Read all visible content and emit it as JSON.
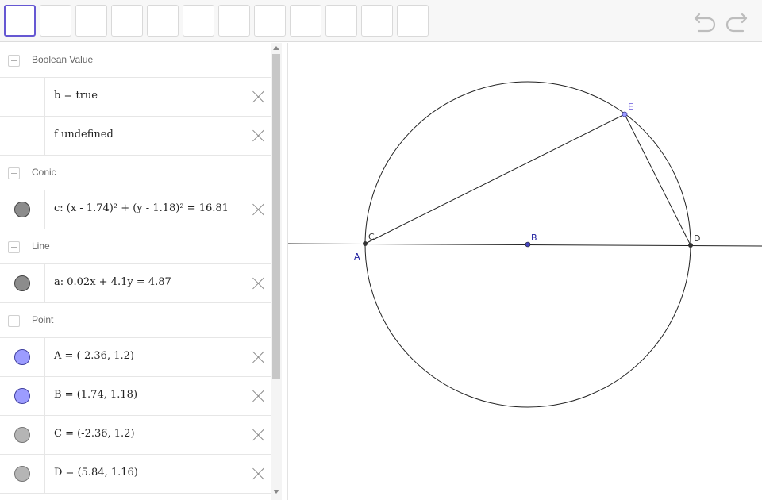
{
  "toolbar": {
    "tool_count": 12,
    "undo_icon": "undo-icon",
    "redo_icon": "redo-icon"
  },
  "algebra": {
    "groups": {
      "boolean": "Boolean Value",
      "conic": "Conic",
      "line": "Line",
      "point": "Point"
    },
    "items": {
      "b": "b = true",
      "f": "f undefined",
      "c": "c: (x - 1.74)² + (y - 1.18)² = 16.81",
      "a": "a: 0.02x + 4.1y = 4.87",
      "A": "A = (-2.36, 1.2)",
      "B": "B = (1.74, 1.18)",
      "C": "C = (-2.36, 1.2)",
      "D": "D = (5.84, 1.16)"
    },
    "colors": {
      "dark_marble": "#8c8c8c",
      "blue_marble": "#9c9cff",
      "gray_marble": "#b5b5b5"
    }
  },
  "graphics": {
    "labels": {
      "A": "A",
      "B": "B",
      "C": "C",
      "D": "D",
      "E": "E"
    },
    "colors": {
      "point_dark": "#333333",
      "point_blue": "#4545c0",
      "label_blue": "#2020a0",
      "label_e": "#7b6ee0"
    }
  }
}
